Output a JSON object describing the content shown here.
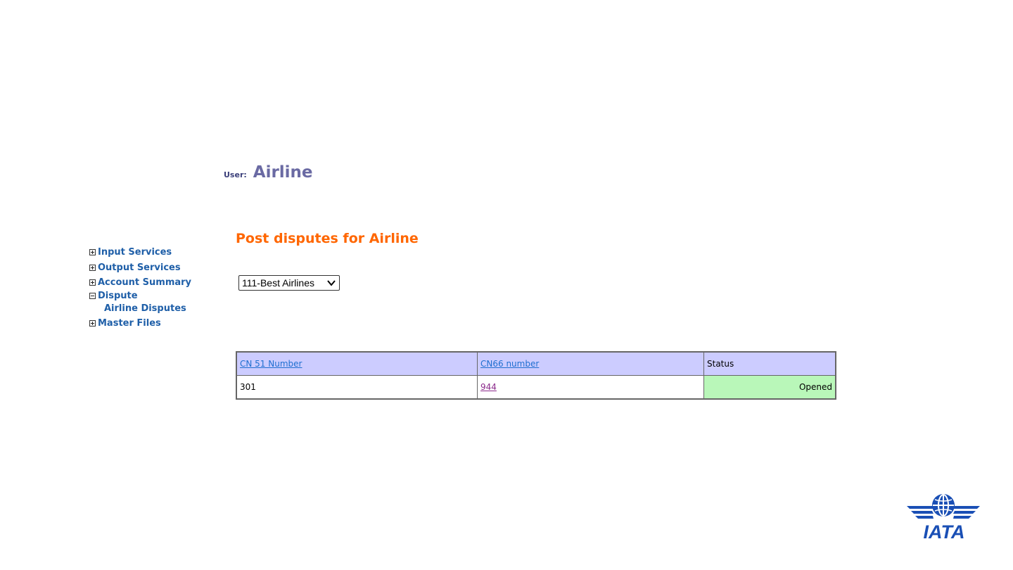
{
  "header": {
    "user_label": "User:",
    "user_name": "Airline"
  },
  "sidebar": {
    "items": [
      {
        "label": "Input Services",
        "state": "collapsed",
        "icon": "plus-box-icon"
      },
      {
        "label": "Output Services",
        "state": "collapsed",
        "icon": "plus-box-icon"
      },
      {
        "label": "Account Summary",
        "state": "collapsed",
        "icon": "plus-box-icon"
      },
      {
        "label": "Dispute",
        "state": "expanded",
        "icon": "minus-box-icon",
        "children": [
          {
            "label": "Airline Disputes"
          }
        ]
      },
      {
        "label": "Master Files",
        "state": "collapsed",
        "icon": "plus-box-icon"
      }
    ]
  },
  "main": {
    "title": "Post disputes for Airline",
    "airline_select": {
      "value": "111-Best Airlines"
    },
    "table": {
      "columns": [
        {
          "label": "CN 51 Number",
          "sortable_link": true
        },
        {
          "label": "CN66 number",
          "sortable_link": true
        },
        {
          "label": "Status",
          "sortable_link": false
        }
      ],
      "rows": [
        {
          "cn51": "301",
          "cn66": "944",
          "status": "Opened"
        }
      ]
    }
  },
  "logo": {
    "text": "IATA",
    "icon": "iata-globe-wings-logo"
  },
  "colors": {
    "title": "#ff6600",
    "nav_link": "#1f5fa8",
    "header_bg": "#ccccff",
    "status_bg": "#b9f7b9",
    "link": "#1f6fd0",
    "visited_link": "#8b2a8b",
    "logo": "#1a4fb5"
  }
}
